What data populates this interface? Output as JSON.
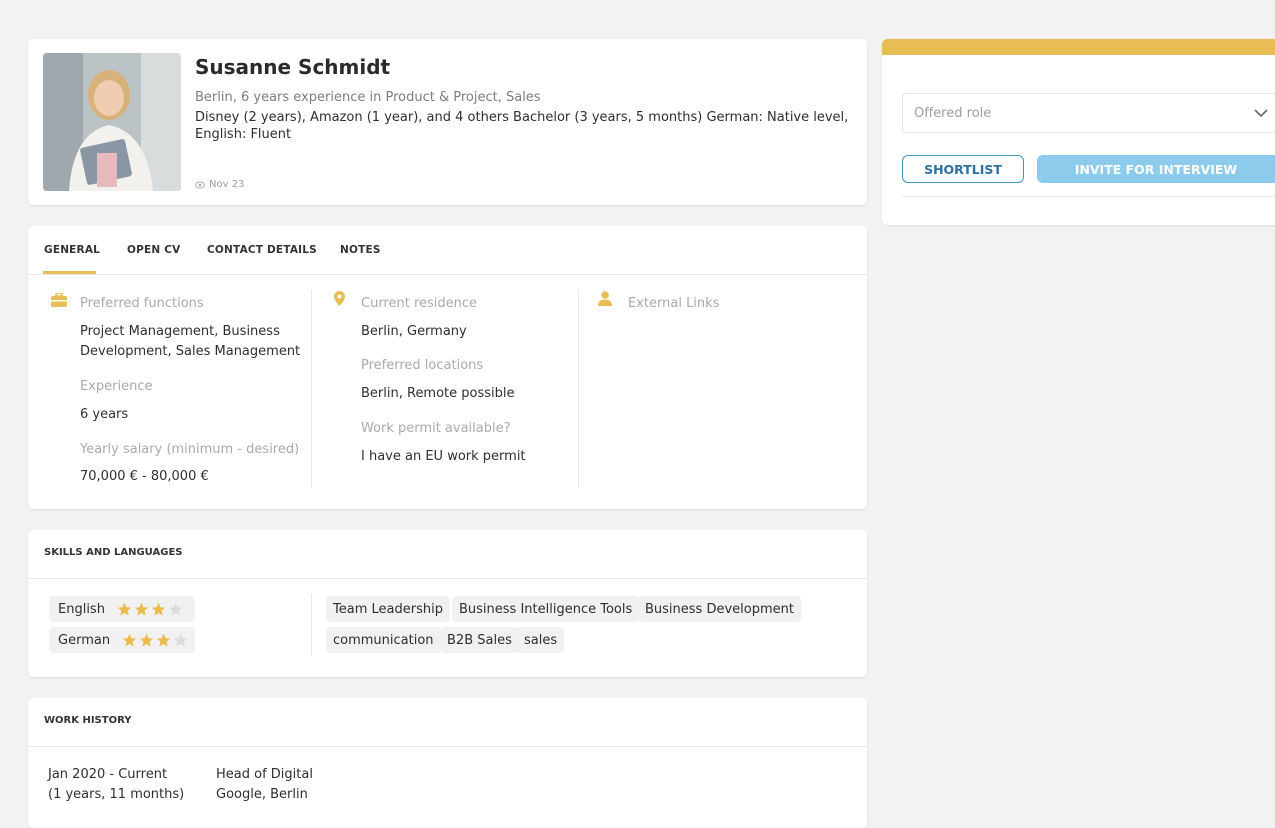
{
  "profile": {
    "name": "Susanne Schmidt",
    "subtitle": "Berlin, 6 years experience in Product & Project, Sales",
    "description": "Disney (2 years), Amazon (1 year), and 4 others Bachelor (3 years, 5 months) German: Native level, English: Fluent",
    "date": "Nov 23"
  },
  "invite": {
    "role_placeholder": "Offered role",
    "shortlist_label": "SHORTLIST",
    "invite_label": "INVITE FOR INTERVIEW"
  },
  "tabs": [
    "GENERAL",
    "OPEN CV",
    "CONTACT DETAILS",
    "NOTES"
  ],
  "general": {
    "preferred_functions_label": "Preferred functions",
    "preferred_functions_line1": "Project Management, Business",
    "preferred_functions_line2": "Development, Sales Management",
    "experience_label": "Experience",
    "experience_value": "6 years",
    "salary_label": "Yearly salary (minimum - desired)",
    "salary_value": "70,000 € - 80,000 €",
    "residence_label": "Current residence",
    "residence_value": "Berlin, Germany",
    "preferred_locations_label": "Preferred locations",
    "preferred_locations_value": "Berlin, Remote possible",
    "work_permit_label": "Work permit available?",
    "work_permit_value": "I have an EU work permit",
    "external_links_label": "External Links"
  },
  "skills": {
    "title": "SKILLS AND LANGUAGES",
    "languages": [
      {
        "name": "English",
        "rating": 3,
        "max": 4
      },
      {
        "name": "German",
        "rating": 3,
        "max": 4
      }
    ],
    "chips": [
      "Team Leadership",
      "Business Intelligence Tools",
      "Business Development",
      "communication",
      "B2B Sales",
      "sales"
    ]
  },
  "work": {
    "title": "WORK HISTORY",
    "entries": [
      {
        "period": "Jan 2020 - Current",
        "duration": "(1 years, 11 months)",
        "role": "Head of Digital",
        "company": "Google, Berlin"
      }
    ]
  },
  "colors": {
    "accent": "#e8bd55",
    "invite_button": "#8dcbec",
    "shortlist_border": "#3f90c9",
    "star_filled": "#eabc4d",
    "star_empty": "#dcdcdc"
  }
}
